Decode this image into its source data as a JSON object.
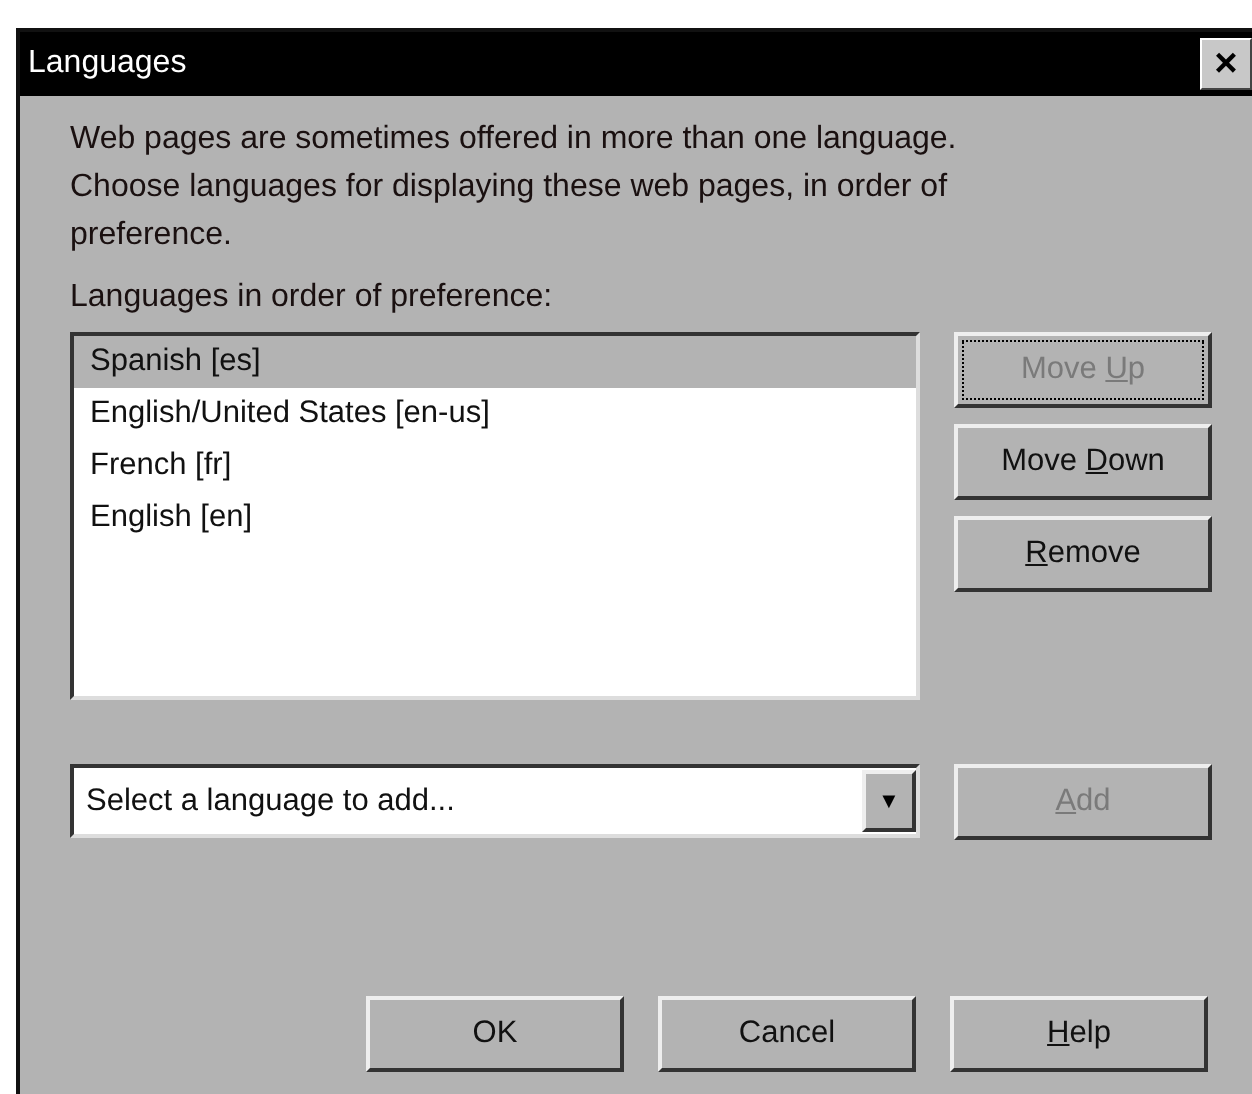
{
  "window": {
    "title": "Languages",
    "close": "×"
  },
  "intro": "Web pages are sometimes offered in more than one language. Choose languages for displaying these web pages, in order of preference.",
  "list_label": "Languages in order of preference:",
  "languages": [
    {
      "label": "Spanish  [es]",
      "selected": true
    },
    {
      "label": "English/United States  [en-us]",
      "selected": false
    },
    {
      "label": "French  [fr]",
      "selected": false
    },
    {
      "label": "English  [en]",
      "selected": false
    }
  ],
  "side_buttons": [
    {
      "label": {
        "before": "Move ",
        "key": "U",
        "after": "p"
      },
      "disabled": true,
      "focused": true
    },
    {
      "label": {
        "before": "Move ",
        "key": "D",
        "after": "own"
      },
      "disabled": false,
      "focused": false
    },
    {
      "label": {
        "key": "R",
        "after": "emove"
      },
      "disabled": false,
      "focused": false
    }
  ],
  "add_select": {
    "value": "Select a language to add...",
    "arrow": "▼"
  },
  "add_button": {
    "label": {
      "key": "A",
      "after": "dd"
    },
    "disabled": true
  },
  "footer_buttons": [
    {
      "label": {
        "before": "OK"
      }
    },
    {
      "label": {
        "before": "Cancel"
      }
    },
    {
      "label": {
        "key": "H",
        "after": "elp"
      }
    }
  ]
}
